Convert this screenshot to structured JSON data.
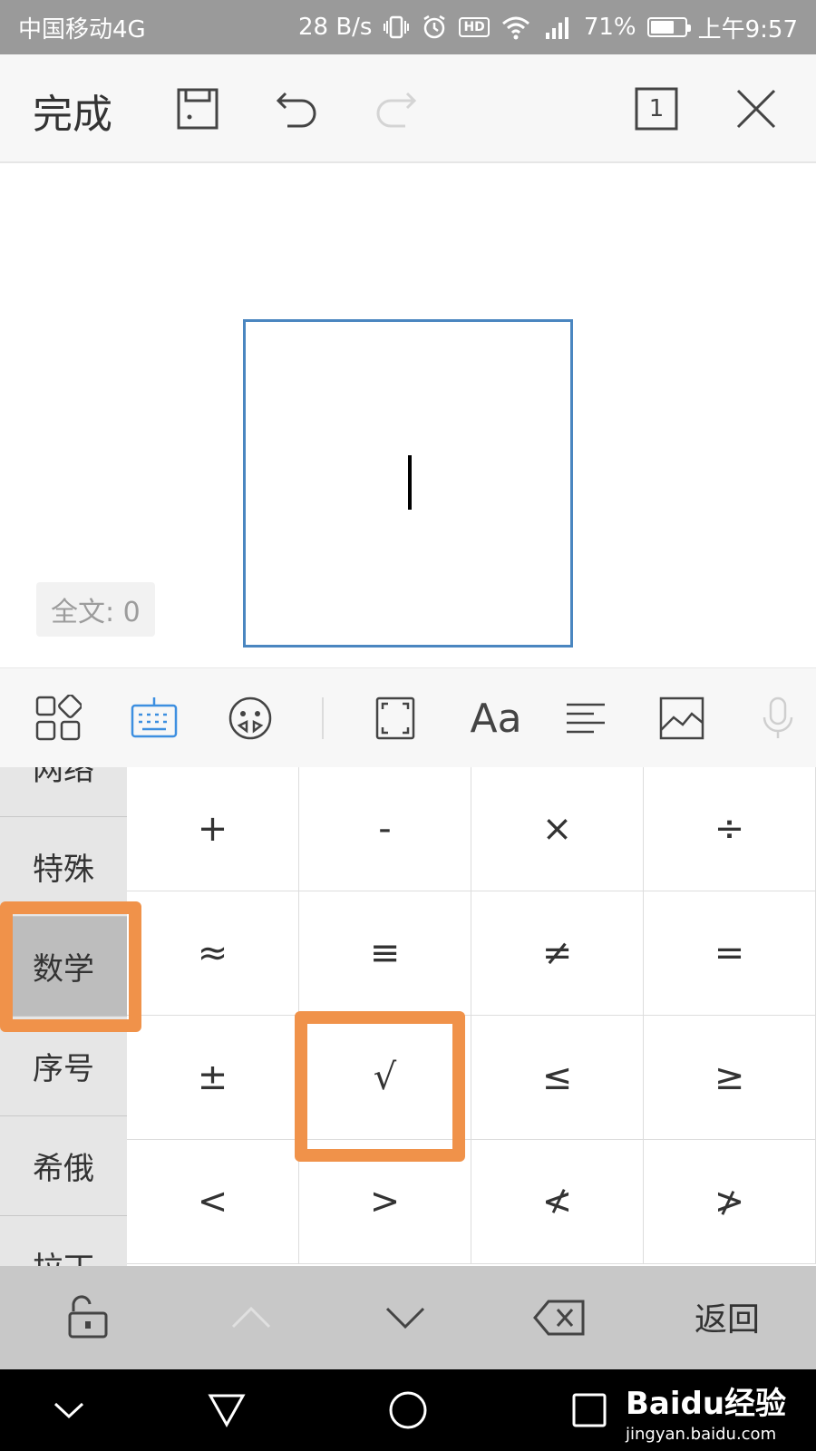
{
  "status_bar": {
    "carrier": "中国移动4G",
    "speed": "28 B/s",
    "battery": "71%",
    "battery_level": 0.71,
    "time": "上午9:57",
    "hd_label": "HD",
    "icons": [
      "vibrate-icon",
      "alarm-icon",
      "hd-icon",
      "wifi-icon",
      "signal-icon",
      "battery-icon"
    ]
  },
  "toolbar": {
    "done_label": "完成",
    "page_count": "1",
    "icons": [
      "save-icon",
      "undo-icon",
      "redo-icon",
      "page-count-icon",
      "close-icon"
    ]
  },
  "editor": {
    "word_count": "全文: 0"
  },
  "input_toolbar": {
    "icons": [
      "apps-icon",
      "keyboard-icon",
      "emoji-icon",
      "fullscreen-icon",
      "font-icon",
      "align-icon",
      "image-icon",
      "mic-icon"
    ],
    "font_glyph": "Aa",
    "active": "keyboard-icon",
    "accent_color": "#3d8fe0"
  },
  "symbol_panel": {
    "categories": [
      "网络",
      "特殊",
      "数学",
      "序号",
      "希俄",
      "拉丁"
    ],
    "active_category": "数学",
    "symbols": [
      "+",
      "-",
      "×",
      "÷",
      "≈",
      "≡",
      "≠",
      "=",
      "±",
      "√",
      "≤",
      "≥",
      "<",
      ">",
      "≮",
      "≯"
    ],
    "highlight_color": "#f0924a"
  },
  "key_bar": {
    "return_label": "返回",
    "icons": [
      "lock-icon",
      "arrow-up-icon",
      "arrow-down-icon",
      "backspace-icon"
    ]
  },
  "nav_bar": {
    "icons": [
      "hide-icon",
      "back-icon",
      "home-icon",
      "recents-icon"
    ]
  },
  "watermark": {
    "logo": "Baidu经验",
    "url": "jingyan.baidu.com"
  }
}
